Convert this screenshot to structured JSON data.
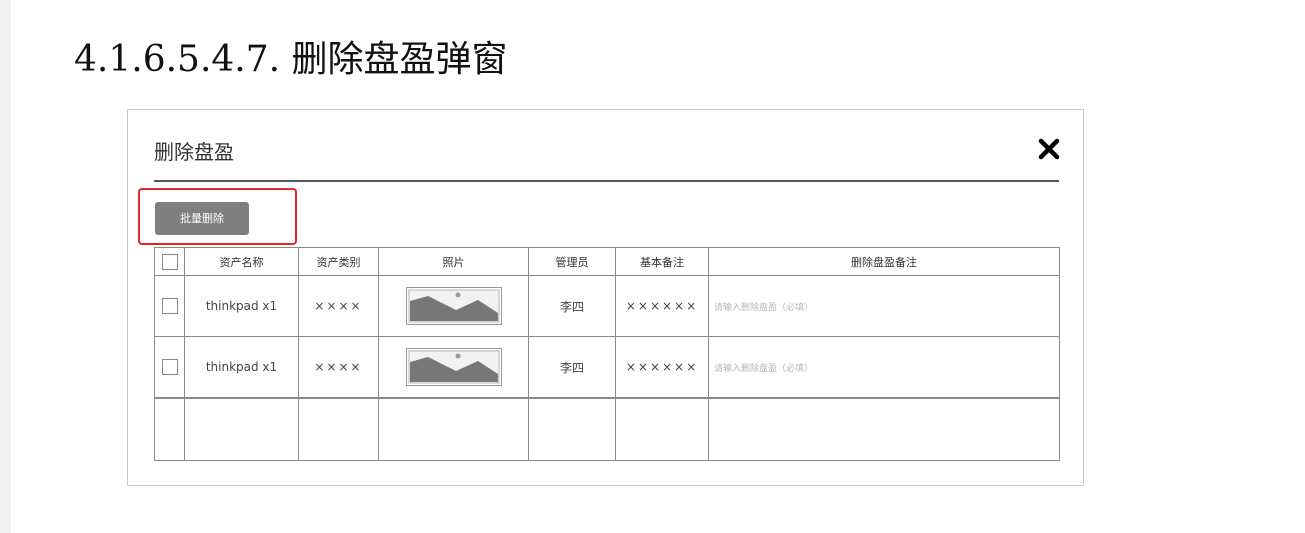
{
  "heading": "4.1.6.5.4.7. 删除盘盈弹窗",
  "modal": {
    "title": "删除盘盈",
    "close_icon": "close-icon",
    "batch_delete_label": "批量删除",
    "highlight_color": "#e5252a"
  },
  "table": {
    "headers": [
      "资产名称",
      "资产类别",
      "照片",
      "管理员",
      "基本备注",
      "删除盘盈备注"
    ],
    "rows": [
      {
        "name": "thinkpad x1",
        "category": "××××",
        "photo_icon": "image-placeholder-icon",
        "admin": "李四",
        "note": "××××××",
        "remark_placeholder": "请输入删除盘盈（必填）"
      },
      {
        "name": "thinkpad x1",
        "category": "××××",
        "photo_icon": "image-placeholder-icon",
        "admin": "李四",
        "note": "××××××",
        "remark_placeholder": "请输入删除盘盈（必填）"
      }
    ]
  }
}
